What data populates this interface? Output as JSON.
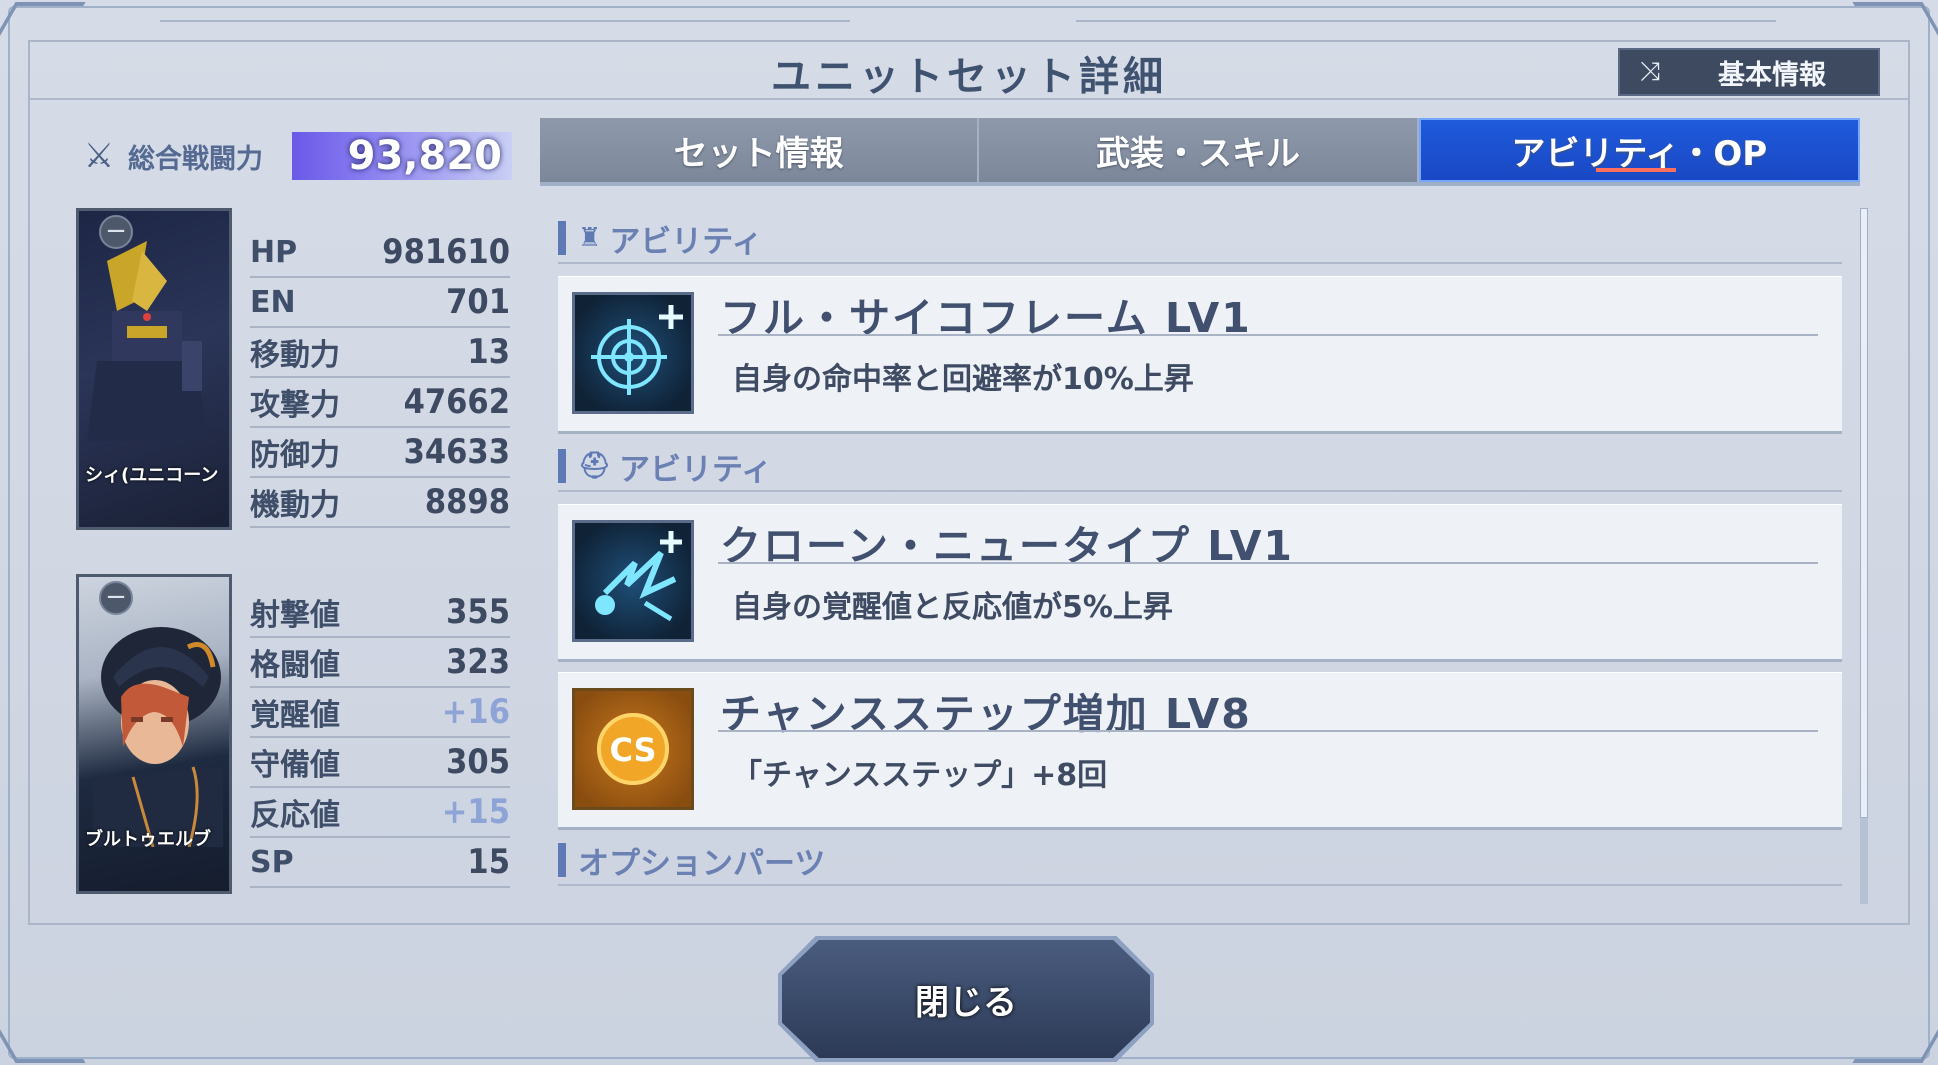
{
  "header": {
    "title": "ユニットセット詳細",
    "basic_info_label": "基本情報"
  },
  "power": {
    "label": "総合戦闘力",
    "value": "93,820"
  },
  "unit": {
    "name": "シィ(ユニコーン",
    "stats": [
      {
        "key": "HP",
        "value": "981610",
        "plus": false
      },
      {
        "key": "EN",
        "value": "701",
        "plus": false
      },
      {
        "key": "移動力",
        "value": "13",
        "plus": false
      },
      {
        "key": "攻撃力",
        "value": "47662",
        "plus": false
      },
      {
        "key": "防御力",
        "value": "34633",
        "plus": false
      },
      {
        "key": "機動力",
        "value": "8898",
        "plus": false
      }
    ]
  },
  "pilot": {
    "name": "ブルトゥエルブ",
    "stats": [
      {
        "key": "射撃値",
        "value": "355",
        "plus": false
      },
      {
        "key": "格闘値",
        "value": "323",
        "plus": false
      },
      {
        "key": "覚醒値",
        "value": "+16",
        "plus": true
      },
      {
        "key": "守備値",
        "value": "305",
        "plus": false
      },
      {
        "key": "反応値",
        "value": "+15",
        "plus": true
      },
      {
        "key": "SP",
        "value": "15",
        "plus": false
      }
    ]
  },
  "tabs": [
    {
      "label": "セット情報",
      "active": false
    },
    {
      "label": "武装・スキル",
      "active": false
    },
    {
      "label": "アビリティ・OP",
      "active": true
    }
  ],
  "sections": {
    "unit_ability": "アビリティ",
    "pilot_ability": "アビリティ",
    "option_parts": "オプションパーツ"
  },
  "abilities": [
    {
      "title": "フル・サイコフレーム LV1",
      "desc": "自身の命中率と回避率が10%上昇",
      "icon": "crosshair-plus-icon"
    },
    {
      "title": "クローン・ニュータイプ LV1",
      "desc": "自身の覚醒値と反応値が5%上昇",
      "icon": "newtype-flash-icon"
    },
    {
      "title": "チャンスステップ増加 LV8",
      "desc": "「チャンスステップ」+8回",
      "icon": "cs-badge-icon",
      "icon_text": "CS"
    }
  ],
  "close_label": "閉じる"
}
